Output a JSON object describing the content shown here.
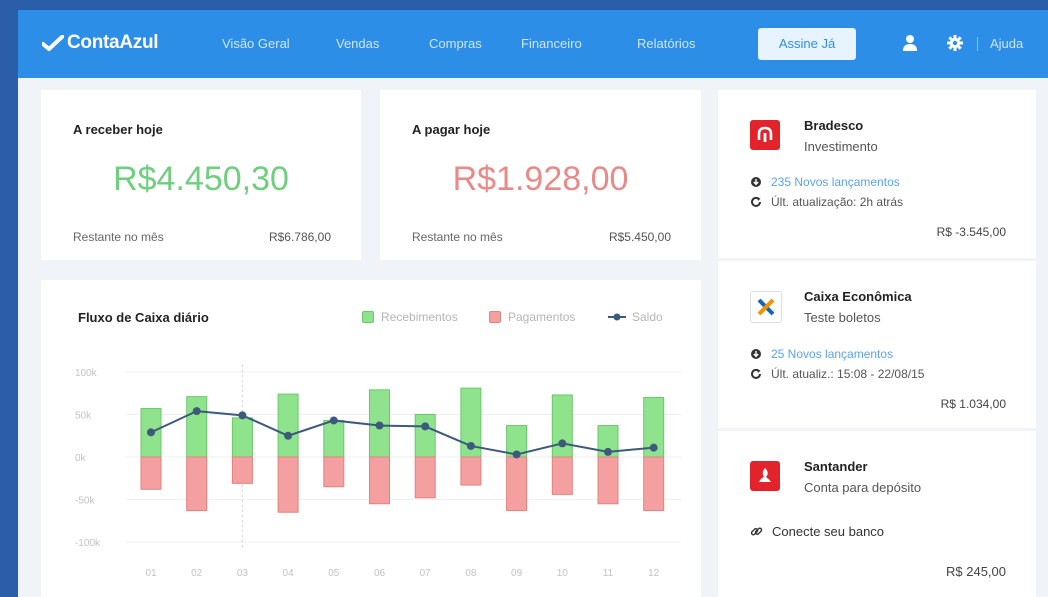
{
  "app": {
    "name": "ContaAzul"
  },
  "nav": {
    "items": [
      "Visão Geral",
      "Vendas",
      "Compras",
      "Financeiro",
      "Relatórios"
    ],
    "cta": "Assine Já",
    "help": "Ajuda",
    "icons": [
      "user-icon",
      "gear-icon"
    ]
  },
  "receivable": {
    "title": "A receber hoje",
    "value": "R$4.450,30",
    "footer_label": "Restante no mês",
    "footer_value": "R$6.786,00",
    "color": "#6fcf7f"
  },
  "payable": {
    "title": "A pagar hoje",
    "value": "R$1.928,00",
    "footer_label": "Restante no mês",
    "footer_value": "R$5.450,00",
    "color": "#e88a88"
  },
  "cashflow": {
    "title": "Fluxo de Caixa diário",
    "legend": [
      "Recebimentos",
      "Pagamentos",
      "Saldo"
    ]
  },
  "chart_data": {
    "type": "bar",
    "categories": [
      "01",
      "02",
      "03",
      "04",
      "05",
      "06",
      "07",
      "08",
      "09",
      "10",
      "11",
      "12"
    ],
    "series": [
      {
        "name": "Recebimentos",
        "type": "bar",
        "color": "#8fe38c",
        "values": [
          57,
          71,
          46,
          74,
          43,
          79,
          50,
          81,
          37,
          73,
          37,
          70
        ]
      },
      {
        "name": "Pagamentos",
        "type": "bar",
        "color": "#f5a0a0",
        "values": [
          -38,
          -63,
          -31,
          -65,
          -35,
          -55,
          -48,
          -33,
          -63,
          -44,
          -55,
          -63
        ]
      },
      {
        "name": "Saldo",
        "type": "line",
        "color": "#3d5a7d",
        "values": [
          29,
          54,
          49,
          25,
          43,
          37,
          36,
          13,
          3,
          16,
          6,
          11
        ]
      }
    ],
    "yticks": [
      "100k",
      "50k",
      "0k",
      "-50k",
      "-100k"
    ],
    "ylim": [
      -100,
      100
    ],
    "marker_at": "03"
  },
  "banks": [
    {
      "name": "Bradesco",
      "subtitle": "Investimento",
      "new_entries": "235 Novos lançamentos",
      "updated": "Últ. atualização: 2h atrás",
      "balance": "R$ -3.545,00",
      "color": "#e2232b",
      "icon": "bradesco-icon"
    },
    {
      "name": "Caixa Econômica",
      "subtitle": "Teste boletos",
      "new_entries": "25 Novos lançamentos",
      "updated": "Últ. atualiz.: 15:08 - 22/08/15",
      "balance": "R$ 1.034,00",
      "color": "#1565b5",
      "icon": "caixa-icon"
    },
    {
      "name": "Santander",
      "subtitle": "Conta para depósito",
      "connect": "Conecte seu banco",
      "balance": "R$ 245,00",
      "color": "#e2232b",
      "icon": "santander-icon"
    }
  ],
  "colors": {
    "accent": "#2d8ee8",
    "link": "#5aa3e8",
    "saldo": "#3d5a7d"
  }
}
